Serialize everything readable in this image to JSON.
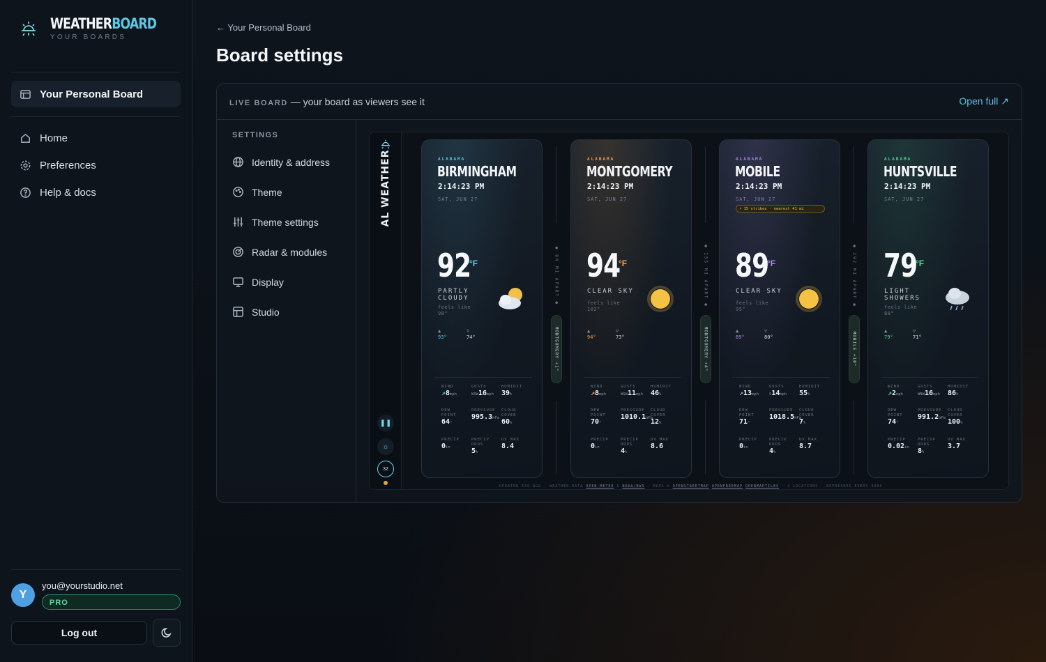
{
  "brand": {
    "name_a": "WEATHER",
    "name_b": "BOARD",
    "subtitle": "YOUR BOARDS"
  },
  "sidebar": {
    "board_label": "Your Personal Board",
    "nav": [
      {
        "label": "Home",
        "icon": "home-icon"
      },
      {
        "label": "Preferences",
        "icon": "gear-icon"
      },
      {
        "label": "Help & docs",
        "icon": "help-icon"
      }
    ],
    "user": {
      "initial": "Y",
      "email": "you@yourstudio.net",
      "plan": "PRO"
    },
    "logout_label": "Log out"
  },
  "header": {
    "breadcrumb": "← Your Personal Board",
    "title": "Board settings"
  },
  "panel": {
    "live_tag": "LIVE BOARD",
    "live_text": " — your board as viewers see it",
    "open_full": "Open full ↗"
  },
  "settings": {
    "heading": "SETTINGS",
    "items": [
      {
        "label": "Identity & address",
        "icon": "globe-icon"
      },
      {
        "label": "Theme",
        "icon": "palette-icon"
      },
      {
        "label": "Theme settings",
        "icon": "sliders-icon"
      },
      {
        "label": "Radar & modules",
        "icon": "radar-icon"
      },
      {
        "label": "Display",
        "icon": "monitor-icon"
      },
      {
        "label": "Studio",
        "icon": "layout-icon"
      }
    ]
  },
  "preview": {
    "rail_title": "AL WEATHER",
    "countdown": "32",
    "cards": [
      {
        "state": "ALABAMA",
        "city": "BIRMINGHAM",
        "time": "2:14:23 PM",
        "date": "SAT, JUN 27",
        "temp": "92",
        "unit": "°F",
        "condition": "PARTLY CLOUDY",
        "feels": "feels like 98°",
        "high": "93°",
        "low": "74°",
        "icon": "partly-cloudy-icon",
        "accent": "#5cc8e6",
        "wind": "8",
        "wind_unit": "mph",
        "gusts": "16",
        "gusts_unit": "mph",
        "gusts_dir": "WSW",
        "humidity": "39",
        "dew": "64",
        "pressure": "995.3",
        "pressure_unit": "hPa",
        "cloud": "60",
        "precip": "0",
        "precip_unit": "in",
        "odds": "5",
        "uv": "8.4"
      },
      {
        "state": "ALABAMA",
        "city": "MONTGOMERY",
        "time": "2:14:23 PM",
        "date": "SAT, JUN 27",
        "temp": "94",
        "unit": "°F",
        "condition": "CLEAR SKY",
        "feels": "feels like 102°",
        "high": "94°",
        "low": "73°",
        "icon": "sun-icon",
        "accent": "#f0a14a",
        "wind": "8",
        "wind_unit": "mph",
        "gusts": "11",
        "gusts_unit": "mph",
        "gusts_dir": "WSW",
        "humidity": "46",
        "dew": "70",
        "pressure": "1010.1",
        "pressure_unit": "hPa",
        "cloud": "12",
        "precip": "0",
        "precip_unit": "in",
        "odds": "4",
        "uv": "8.6"
      },
      {
        "state": "ALABAMA",
        "city": "MOBILE",
        "time": "2:14:23 PM",
        "date": "SAT, JUN 27",
        "strike": "⚡ 15 strikes · nearest 41 mi",
        "temp": "89",
        "unit": "°F",
        "condition": "CLEAR SKY",
        "feels": "feels like 95°",
        "high": "89°",
        "low": "80°",
        "icon": "sun-icon",
        "accent": "#a98be8",
        "wind": "13",
        "wind_unit": "mph",
        "gusts": "14",
        "gusts_unit": "mph",
        "gusts_dir": "S",
        "humidity": "55",
        "dew": "71",
        "pressure": "1018.5",
        "pressure_unit": "hPa",
        "cloud": "7",
        "precip": "0",
        "precip_unit": "in",
        "odds": "4",
        "uv": "8.7"
      },
      {
        "state": "ALABAMA",
        "city": "HUNTSVILLE",
        "time": "2:14:23 PM",
        "date": "SAT, JUN 27",
        "temp": "79",
        "unit": "°F",
        "condition": "LIGHT SHOWERS",
        "feels": "feels like 88°",
        "high": "79°",
        "low": "71°",
        "icon": "rain-cloud-icon",
        "accent": "#4fd68f",
        "wind": "2",
        "wind_unit": "mph",
        "gusts": "16",
        "gusts_unit": "mph",
        "gusts_dir": "WNW",
        "humidity": "86",
        "dew": "74",
        "pressure": "991.2",
        "pressure_unit": "hPa",
        "cloud": "100",
        "precip": "0.02",
        "precip_unit": "in",
        "odds": "8",
        "uv": "3.7"
      }
    ],
    "labels": {
      "wind": "WIND",
      "gusts": "GUSTS",
      "humidity": "HUMIDIT",
      "dew": "DEW POINT",
      "pressure": "PRESSURE",
      "cloud": "CLOUD COVER",
      "precip": "PRECIP",
      "odds": "PRECIP ODDS",
      "uv": "UV MAX"
    },
    "separators": [
      {
        "distance": "● 84 MI APART ●",
        "pill": "MONTGOMERY +1°"
      },
      {
        "distance": "● 155 MI APART ●",
        "pill": "MONTGOMERY +4°"
      },
      {
        "distance": "● 292 MI APART ●",
        "pill": "MOBILE +10°"
      }
    ],
    "footer": {
      "updated": "UPDATED 63S AGO",
      "data_label": "WEATHER DATA",
      "src1": "OPEN-METEO",
      "src2": "NOAA/NWS",
      "maps_label": "MAPS ©",
      "map1": "OPENSTREETMAP",
      "map2": "OPENFREEMAP",
      "map3": "OPENMAPTILES",
      "locations": "4 LOCATIONS",
      "refresh": "REFRESHES EVERY 900S"
    }
  }
}
